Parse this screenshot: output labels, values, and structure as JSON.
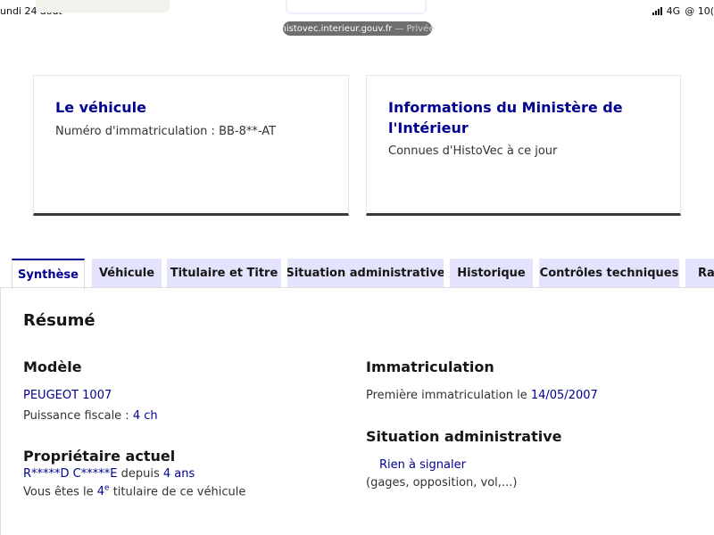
{
  "status_bar": {
    "date": "undi 24 août",
    "network": "4G",
    "battery_text": "@ 10("
  },
  "browser": {
    "url": "histovec.interieur.gouv.fr",
    "private_label": "— Privée"
  },
  "cards": {
    "vehicle": {
      "title": "Le véhicule",
      "plate_label": "Numéro d'immatriculation : BB-8**-AT"
    },
    "ministere": {
      "title_line1": "Informations du Ministère de",
      "title_line2": "l'Intérieur",
      "subtitle": "Connues d'HistoVec à ce jour"
    }
  },
  "tabs": [
    {
      "label": "Synthèse",
      "active": true
    },
    {
      "label": "Véhicule",
      "active": false
    },
    {
      "label": "Titulaire et Titre",
      "active": false
    },
    {
      "label": "Situation administrative",
      "active": false
    },
    {
      "label": "Historique",
      "active": false
    },
    {
      "label": "Contrôles techniques",
      "active": false
    },
    {
      "label": "Rap",
      "active": false
    }
  ],
  "summary": {
    "title": "Résumé",
    "modele": {
      "heading": "Modèle",
      "model_name": "PEUGEOT 1007",
      "puissance_label": "Puissance fiscale :",
      "puissance_value": "4 ch"
    },
    "proprietaire": {
      "heading": "Propriétaire actuel",
      "name": "R*****D C*****E",
      "depuis_label": "depuis",
      "duration": "4 ans",
      "rank_prefix": "Vous êtes le",
      "rank_number": "4",
      "rank_sup": "e",
      "rank_suffix": "titulaire de ce véhicule"
    },
    "immatriculation": {
      "heading": "Immatriculation",
      "first_label": "Première immatriculation le",
      "first_date": "14/05/2007"
    },
    "situation": {
      "heading": "Situation administrative",
      "status": "Rien à signaler",
      "details": "(gages, opposition, vol,...)"
    }
  },
  "colors": {
    "primary_blue": "#000091",
    "tab_background": "#e3e3fd"
  }
}
